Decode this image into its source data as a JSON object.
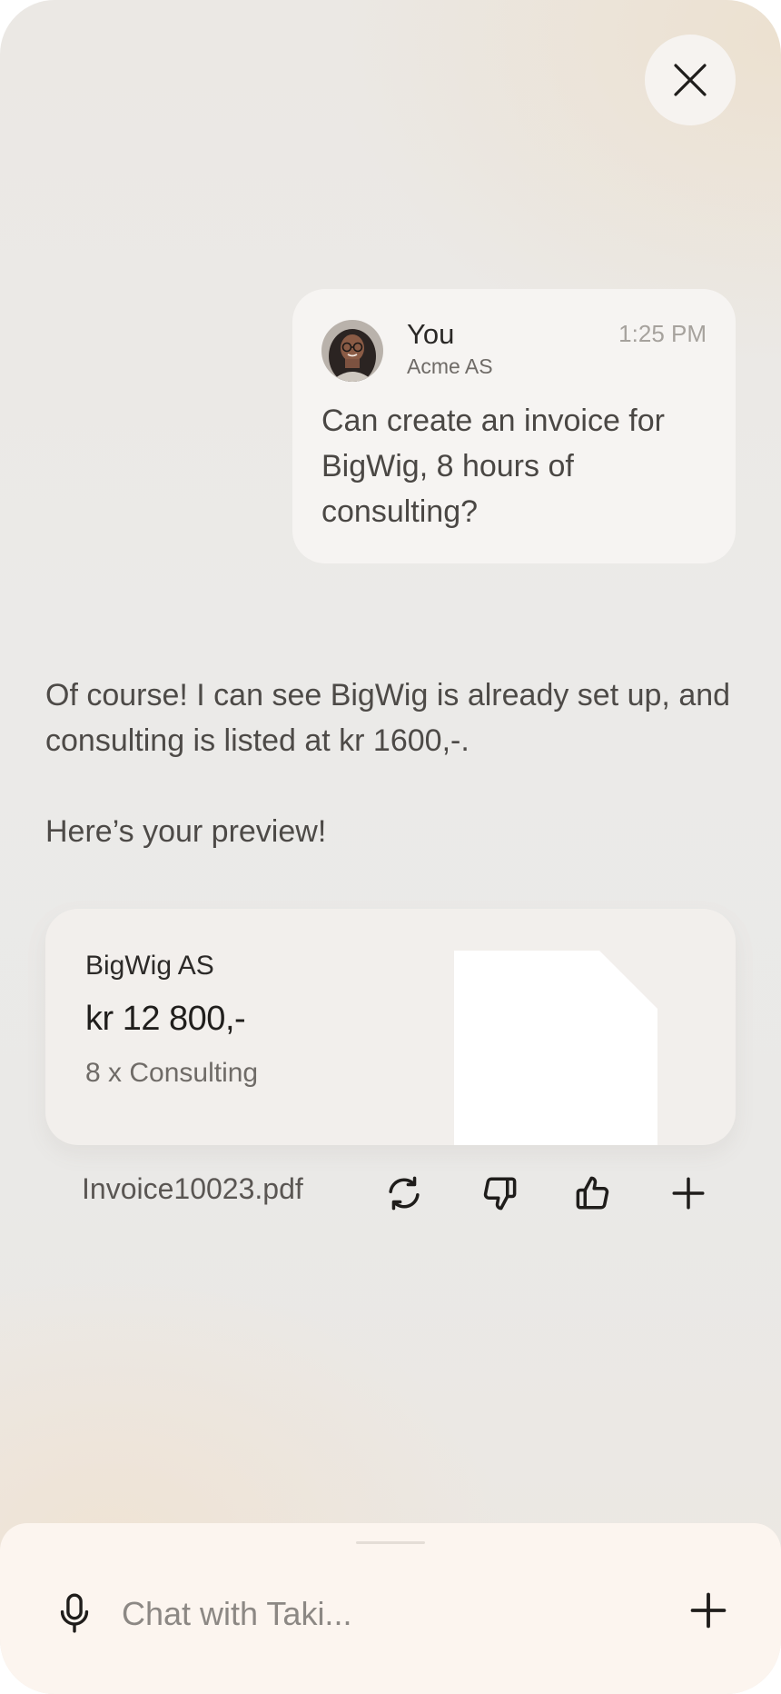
{
  "header": {
    "close_icon": "close-icon"
  },
  "user_message": {
    "sender": "You",
    "organization": "Acme AS",
    "time": "1:25 PM",
    "text": "Can create an invoice for BigWig, 8 hours of consulting?"
  },
  "assistant_message": {
    "paragraph1": "Of course! I can see BigWig is already set up, and consulting is listed at kr 1600,-.",
    "paragraph2": "Here’s your preview!"
  },
  "invoice": {
    "client": "BigWig AS",
    "amount": "kr 12 800,-",
    "line": "8 x Consulting",
    "file_name": "Invoice10023.pdf"
  },
  "actions": [
    "refresh-icon",
    "thumbs-down-icon",
    "thumbs-up-icon",
    "plus-icon"
  ],
  "composer": {
    "placeholder": "Chat with Taki...",
    "mic_icon": "microphone-icon",
    "add_icon": "plus-icon"
  }
}
